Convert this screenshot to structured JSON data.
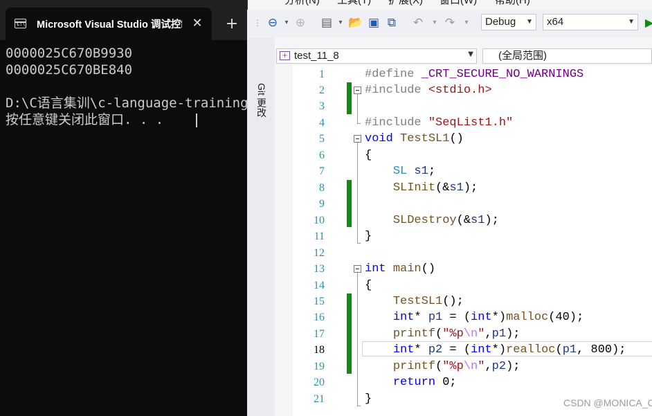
{
  "terminal": {
    "tab_title": "Microsoft Visual Studio 调试控制台",
    "tab_icon": "console-window-icon",
    "close_glyph": "✕",
    "new_tab_glyph": "+",
    "output_lines": [
      "0000025C670B9930",
      "0000025C670BE840",
      "",
      "D:\\C语言集训\\c-language-training",
      "按任意键关闭此窗口. . ."
    ]
  },
  "vs": {
    "menu": [
      "分析(N)",
      "工具(T)",
      "扩展(X)",
      "窗口(W)",
      "帮助(H)"
    ],
    "toolbar": {
      "config": "Debug",
      "platform": "x64"
    },
    "git_tab": "Git 更改",
    "nav": {
      "file": "test_11_8",
      "scope": "(全局范围)"
    },
    "line_numbers": [
      "1",
      "2",
      "3",
      "4",
      "5",
      "6",
      "7",
      "8",
      "9",
      "10",
      "11",
      "12",
      "13",
      "14",
      "15",
      "16",
      "17",
      "18",
      "19",
      "20",
      "21"
    ],
    "current_line": "18",
    "code": {
      "l1_pp": "#define ",
      "l1_mac": "_CRT_SECURE_NO_WARNINGS",
      "l2_pp": "#include ",
      "l2_str": "<stdio.h>",
      "l4_pp": "#include ",
      "l4_str": "\"SeqList1.h\"",
      "l5_kw": "void",
      "l5_fn": "TestSL1",
      "l5_rest": "()",
      "l6": "{",
      "l7_typ": "SL",
      "l7_id": "s1",
      "l7_rest": ";",
      "l8_fn": "SLInit",
      "l8_a": "(&",
      "l8_id": "s1",
      "l8_b": ");",
      "l10_fn": "SLDestroy",
      "l10_a": "(&",
      "l10_id": "s1",
      "l10_b": ");",
      "l11": "}",
      "l13_kw": "int",
      "l13_fn": "main",
      "l13_rest": "()",
      "l14": "{",
      "l15_fn": "TestSL1",
      "l15_rest": "();",
      "l16_kw": "int",
      "l16_a": "* ",
      "l16_id": "p1",
      "l16_b": " = (",
      "l16_kw2": "int",
      "l16_c": "*)",
      "l16_fn": "malloc",
      "l16_d": "(40);",
      "l17_fn": "printf",
      "l17_a": "(",
      "l17_s1": "\"%p",
      "l17_esc": "\\n",
      "l17_s2": "\"",
      "l17_b": ",",
      "l17_id": "p1",
      "l17_c": ");",
      "l18_kw": "int",
      "l18_a": "* ",
      "l18_id": "p2",
      "l18_b": " = (",
      "l18_kw2": "int",
      "l18_c": "*)",
      "l18_fn": "realloc",
      "l18_d": "(",
      "l18_id2": "p1",
      "l18_e": ", 800);",
      "l19_fn": "printf",
      "l19_a": "(",
      "l19_s1": "\"%p",
      "l19_esc": "\\n",
      "l19_s2": "\"",
      "l19_b": ",",
      "l19_id": "p2",
      "l19_c": ");",
      "l20_kw": "return",
      "l20_rest": " 0;",
      "l21": "}"
    },
    "watermark": "CSDN @MONICA_CZT"
  }
}
